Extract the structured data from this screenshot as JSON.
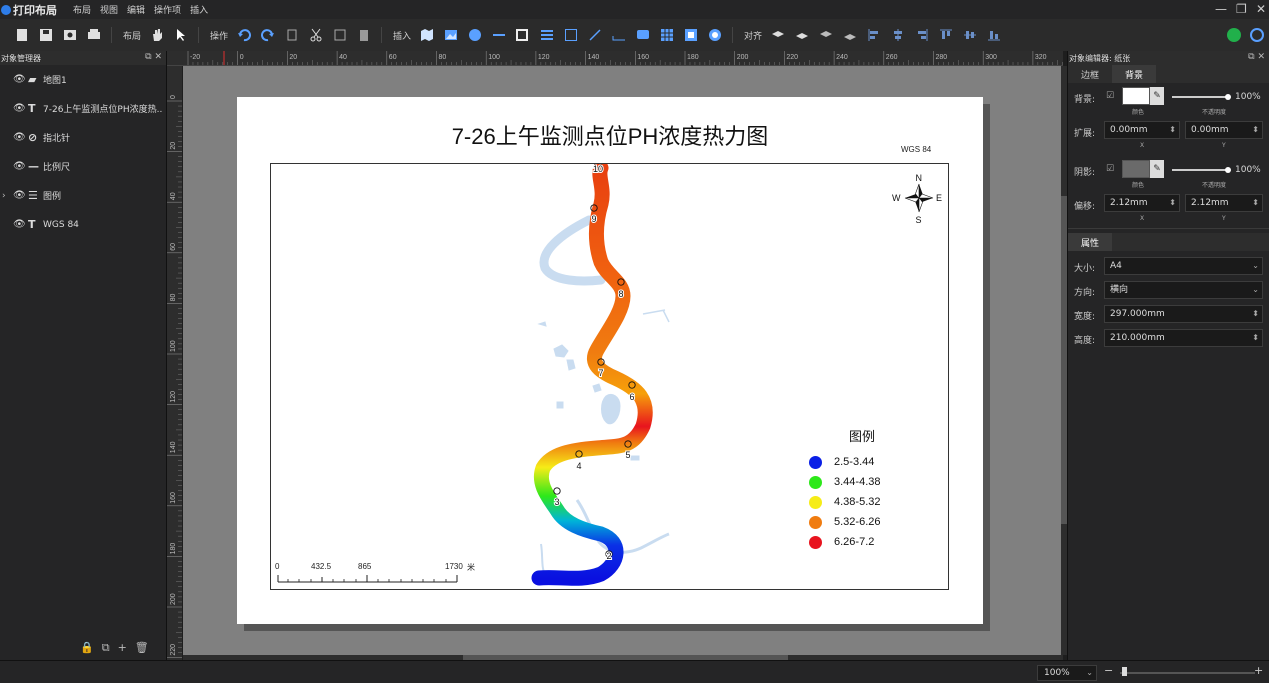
{
  "app": {
    "title": "打印布局",
    "menu": [
      "布局",
      "视图",
      "编辑",
      "操作项",
      "插入"
    ]
  },
  "toolbar": {
    "layout_label": "布局",
    "operate_label": "操作",
    "insert_label": "插入",
    "align_label": "对齐"
  },
  "object_manager": {
    "title": "对象管理器",
    "items": [
      {
        "label": "地图1",
        "icon": "folder-icon"
      },
      {
        "label": "7-26上午监测点位PH浓度热...",
        "icon": "text-icon"
      },
      {
        "label": "指北针",
        "icon": "compass-icon"
      },
      {
        "label": "比例尺",
        "icon": "scalebar-icon"
      },
      {
        "label": "图例",
        "icon": "legend-icon"
      },
      {
        "label": "WGS 84",
        "icon": "text-icon"
      }
    ]
  },
  "ruler_top": [
    "-20",
    "0",
    "20",
    "40",
    "60",
    "80",
    "100",
    "120",
    "140",
    "160",
    "180",
    "200",
    "220",
    "240",
    "260",
    "280",
    "300",
    "320"
  ],
  "ruler_left": [
    "0",
    "20",
    "40",
    "60",
    "80",
    "100",
    "120",
    "140",
    "160",
    "180",
    "200",
    "220"
  ],
  "map": {
    "title": "7-26上午监测点位PH浓度热力图",
    "crs_label": "WGS 84",
    "north": {
      "n": "N",
      "s": "S",
      "e": "E",
      "w": "W"
    },
    "points": [
      "2",
      "3",
      "4",
      "5",
      "6",
      "7",
      "8",
      "9",
      "10"
    ],
    "legend": {
      "title": "图例",
      "items": [
        {
          "label": "2.5-3.44",
          "color": "#0a1fe6"
        },
        {
          "label": "3.44-4.38",
          "color": "#2de81a"
        },
        {
          "label": "4.38-5.32",
          "color": "#f6ec17"
        },
        {
          "label": "5.32-6.26",
          "color": "#f07c10"
        },
        {
          "label": "6.26-7.2",
          "color": "#e8141e"
        }
      ]
    },
    "scalebar": {
      "ticks": [
        "0",
        "432.5",
        "865",
        "1730"
      ],
      "unit": "米"
    }
  },
  "object_editor": {
    "title": "对象编辑器: 纸张",
    "tabs": [
      "边框",
      "背景"
    ],
    "background": {
      "bg_label": "背景:",
      "bg_color_sub": "颜色",
      "bg_opacity": "100%",
      "bg_opacity_sub": "不透明度",
      "expand_label": "扩展:",
      "expand_x": "0.00mm",
      "expand_y": "0.00mm",
      "x_sub": "X",
      "y_sub": "Y",
      "shadow_label": "阴影:",
      "shadow_color_sub": "颜色",
      "shadow_opacity": "100%",
      "shadow_opacity_sub": "不透明度",
      "offset_label": "偏移:",
      "offset_x": "2.12mm",
      "offset_y": "2.12mm"
    },
    "properties": {
      "tab": "属性",
      "size_label": "大小:",
      "size_value": "A4",
      "orient_label": "方向:",
      "orient_value": "横向",
      "width_label": "宽度:",
      "width_value": "297.000mm",
      "height_label": "高度:",
      "height_value": "210.000mm"
    }
  },
  "status": {
    "zoom": "100%"
  }
}
